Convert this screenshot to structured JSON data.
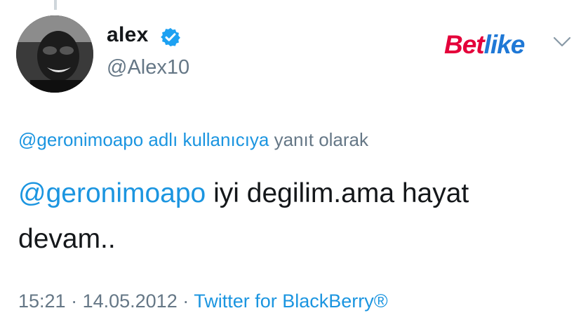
{
  "tweet": {
    "display_name": "alex",
    "handle": "@Alex10",
    "reply_context": {
      "mention": "@geronimoapo adlı kullanıcıya",
      "suffix": " yanıt olarak"
    },
    "text": {
      "mention": "@geronimoapo",
      "body": " iyi degilim.ama hayat devam.."
    },
    "time": "15:21",
    "separator": " · ",
    "date": "14.05.2012",
    "source": "Twitter for BlackBerry®"
  },
  "watermark": {
    "part1": "Bet",
    "part2": "like"
  },
  "icons": {
    "verified": "verified-badge-icon",
    "menu": "chevron-down-icon"
  },
  "colors": {
    "link": "#1b95e0",
    "secondary_text": "#657786",
    "primary_text": "#14171a",
    "verified": "#1da1f2",
    "watermark_red": "#e4003a",
    "watermark_blue": "#1f78d6"
  }
}
